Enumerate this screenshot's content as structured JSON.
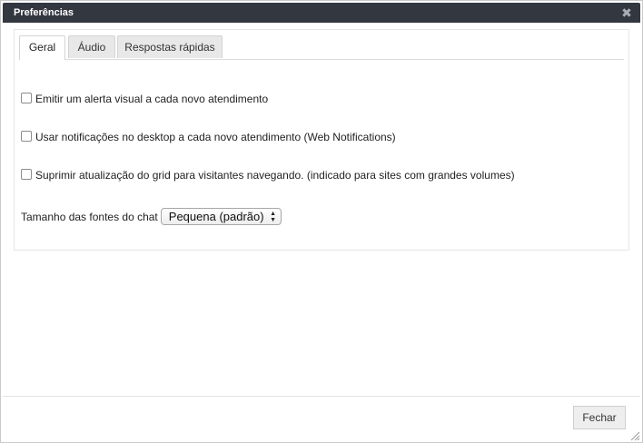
{
  "dialog": {
    "title": "Preferências",
    "close_glyph": "✖"
  },
  "tabs": [
    {
      "label": "Geral",
      "active": true
    },
    {
      "label": "Áudio",
      "active": false
    },
    {
      "label": "Respostas rápidas",
      "active": false
    }
  ],
  "general": {
    "options": [
      {
        "label": "Emitir um alerta visual a cada novo atendimento",
        "checked": false
      },
      {
        "label": "Usar notificações no desktop a cada novo atendimento (Web Notifications)",
        "checked": false
      },
      {
        "label": "Suprimir atualização do grid para visitantes navegando. (indicado para sites com grandes volumes)",
        "checked": false
      }
    ],
    "font_size": {
      "label": "Tamanho das fontes do chat",
      "selected": "Pequena (padrão)"
    }
  },
  "footer": {
    "close_label": "Fechar"
  },
  "icons": {
    "close": "close-icon",
    "select_arrows": "chevron-up-down-icon",
    "resize": "resize-grip-icon"
  },
  "colors": {
    "titlebar": "#333740",
    "tab_inactive": "#e8e8e8",
    "button": "#eeeeee"
  }
}
